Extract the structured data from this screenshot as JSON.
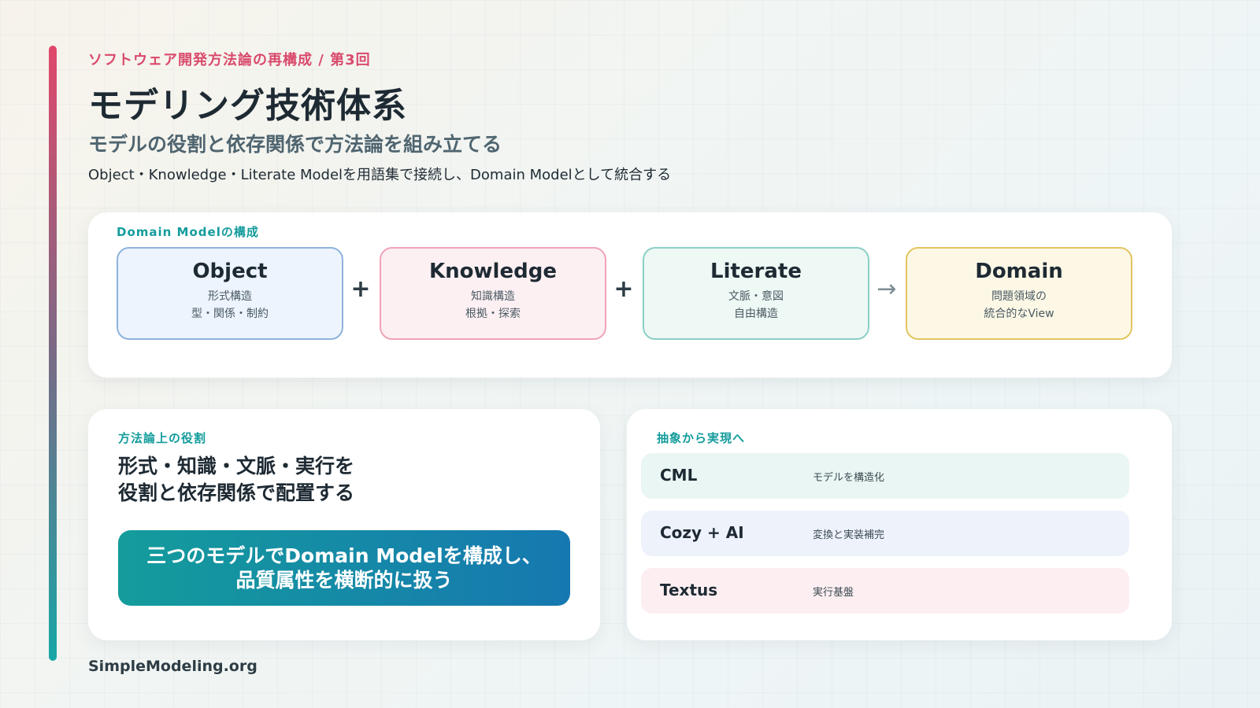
{
  "header": {
    "kicker": "ソフトウェア開発方法論の再構成 / 第3回",
    "title": "モデリング技術体系",
    "subtitle": "モデルの役割と依存関係で方法論を組み立てる",
    "lead": "Object・Knowledge・Literate Modelを用語集で接続し、Domain Modelとして統合する"
  },
  "composition": {
    "label": "Domain Modelの構成",
    "models": [
      {
        "name": "Object",
        "line1": "形式構造",
        "line2": "型・関係・制約",
        "color": "#8fb3dc"
      },
      {
        "name": "Knowledge",
        "line1": "知識構造",
        "line2": "根拠・探索",
        "color": "#f0a3b8"
      },
      {
        "name": "Literate",
        "line1": "文脈・意図",
        "line2": "自由構造",
        "color": "#8ccfc6"
      },
      {
        "name": "Domain",
        "line1": "問題領域の",
        "line2": "統合的なView",
        "color": "#e2c560"
      }
    ],
    "operators": [
      "+",
      "+",
      "→"
    ]
  },
  "role": {
    "label": "方法論上の役割",
    "heading_line1": "形式・知識・文脈・実行を",
    "heading_line2": "役割と依存関係で配置する",
    "banner_line1": "三つのモデルでDomain Modelを構成し、",
    "banner_line2": "品質属性を横断的に扱う"
  },
  "implementation": {
    "label": "抽象から実現へ",
    "rows": [
      {
        "name": "CML",
        "desc": "モデルを構造化",
        "bg": "#eaf6f3"
      },
      {
        "name": "Cozy + AI",
        "desc": "変換と実装補完",
        "bg": "#edf2fb"
      },
      {
        "name": "Textus",
        "desc": "実行基盤",
        "bg": "#fdeff1"
      }
    ]
  },
  "footer": {
    "site": "SimpleModeling.org"
  },
  "colors": {
    "accent_pink": "#d94a6c",
    "accent_teal": "#149c9c",
    "banner_end": "#1678b0"
  }
}
